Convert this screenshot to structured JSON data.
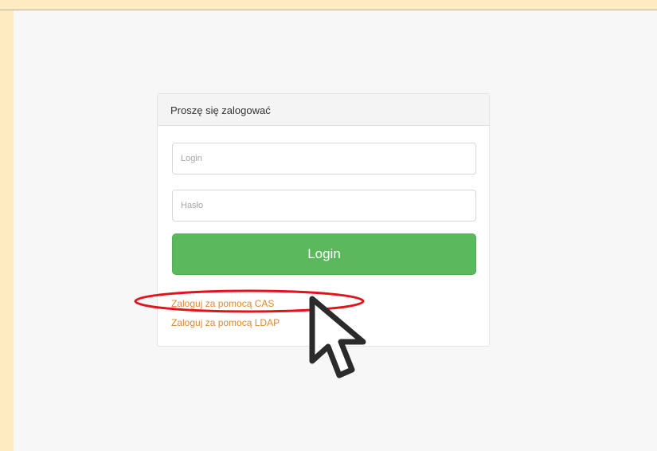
{
  "login_panel": {
    "title": "Proszę się zalogować",
    "login_placeholder": "Login",
    "password_placeholder": "Hasło",
    "login_button_label": "Login",
    "links": [
      {
        "label": "Zaloguj za pomocą CAS"
      },
      {
        "label": "Zaloguj za pomocą LDAP"
      }
    ]
  },
  "annotations": {
    "highlight_color": "#e3121b",
    "cursor_icon": "mouse-pointer-icon"
  },
  "colors": {
    "frame_background": "#fdebc2",
    "page_background": "#f7f7f7",
    "button_green": "#5cb85c",
    "link_orange": "#e0892b"
  }
}
